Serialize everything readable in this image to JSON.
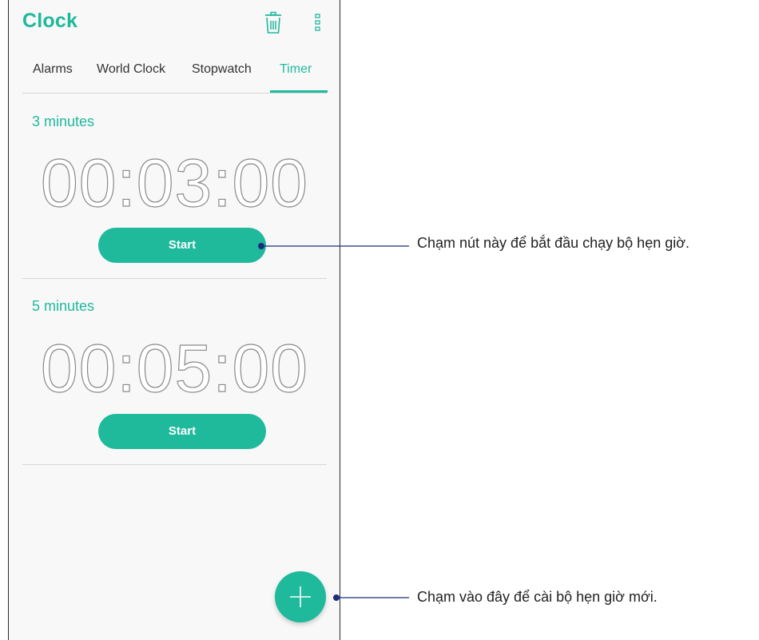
{
  "app": {
    "title": "Clock"
  },
  "toolbar": {
    "delete_icon": "trash-icon",
    "more_icon": "more-vertical-icon"
  },
  "tabs": [
    {
      "label": "Alarms",
      "active": false
    },
    {
      "label": "World Clock",
      "active": false
    },
    {
      "label": "Stopwatch",
      "active": false
    },
    {
      "label": "Timer",
      "active": true
    }
  ],
  "timers": [
    {
      "label": "3 minutes",
      "value": "00:03:00",
      "start_label": "Start"
    },
    {
      "label": "5 minutes",
      "value": "00:05:00",
      "start_label": "Start"
    }
  ],
  "fab": {
    "icon": "plus-icon"
  },
  "callouts": {
    "start": "Chạm nút này để bắt đầu chạy  bộ hẹn giờ.",
    "add": "Chạm vào đây để cài bộ hẹn giờ mới."
  },
  "colors": {
    "accent": "#1fb99c",
    "background": "#f8f8f8",
    "divider": "#d6d6d6"
  }
}
